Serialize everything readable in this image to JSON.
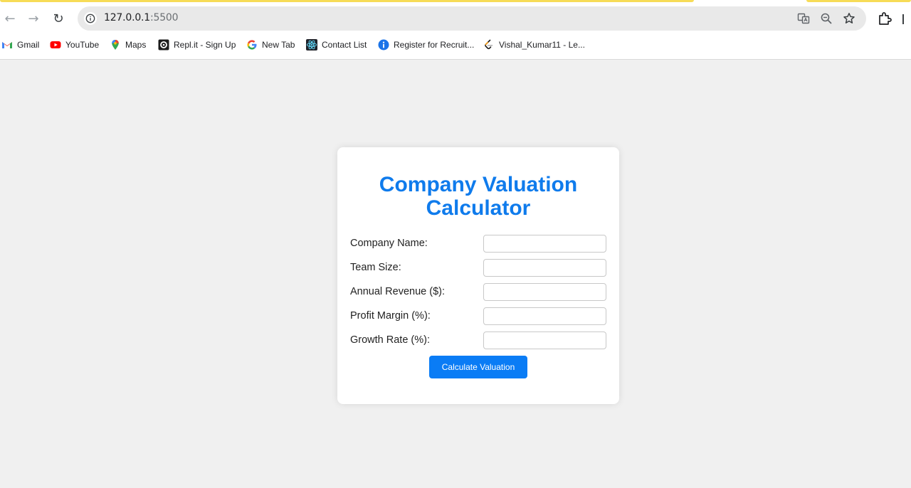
{
  "browser": {
    "url_host": "127.0.0.1",
    "url_port": ":5500",
    "bookmarks": [
      {
        "label": "Gmail",
        "icon": "gmail-icon"
      },
      {
        "label": "YouTube",
        "icon": "youtube-icon"
      },
      {
        "label": "Maps",
        "icon": "maps-icon"
      },
      {
        "label": "Repl.it - Sign Up",
        "icon": "replit-icon"
      },
      {
        "label": "New Tab",
        "icon": "google-icon"
      },
      {
        "label": "Contact List",
        "icon": "react-icon"
      },
      {
        "label": "Register for Recruit...",
        "icon": "info-circle-icon"
      },
      {
        "label": "Vishal_Kumar11 - Le...",
        "icon": "leetcode-icon"
      }
    ]
  },
  "form": {
    "title": "Company Valuation Calculator",
    "fields": [
      {
        "label": "Company Name:",
        "value": ""
      },
      {
        "label": "Team Size:",
        "value": ""
      },
      {
        "label": "Annual Revenue ($):",
        "value": ""
      },
      {
        "label": "Profit Margin (%):",
        "value": ""
      },
      {
        "label": "Growth Rate (%):",
        "value": ""
      }
    ],
    "submit_label": "Calculate Valuation"
  },
  "colors": {
    "accent": "#0f7bec",
    "button": "#0a7cf5",
    "page_background": "#f0f0f0",
    "highlight_strip": "#f7dc57"
  }
}
